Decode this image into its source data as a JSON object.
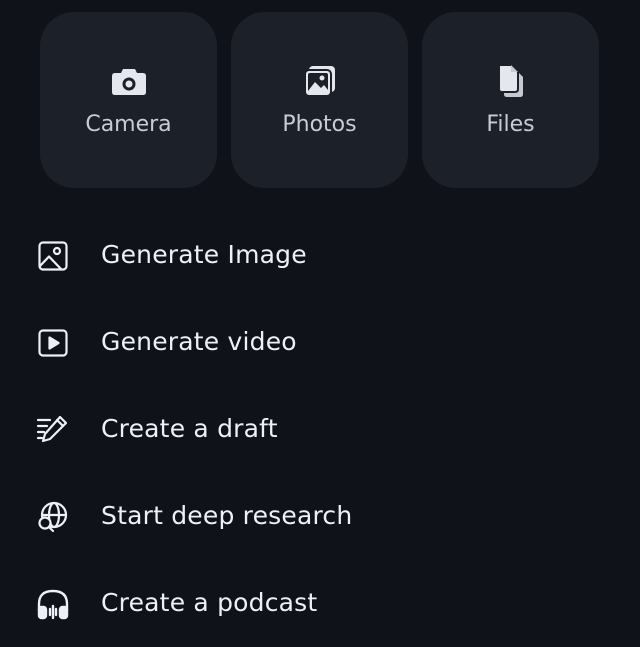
{
  "quick_actions": [
    {
      "label": "Camera",
      "icon": "camera-icon"
    },
    {
      "label": "Photos",
      "icon": "photos-icon"
    },
    {
      "label": "Files",
      "icon": "files-icon"
    }
  ],
  "menu": {
    "items": [
      {
        "label": "Generate Image",
        "icon": "image-icon"
      },
      {
        "label": "Generate video",
        "icon": "video-play-icon"
      },
      {
        "label": "Create a draft",
        "icon": "pen-lines-icon"
      },
      {
        "label": "Start deep research",
        "icon": "globe-search-icon"
      },
      {
        "label": "Create a podcast",
        "icon": "headphones-icon"
      }
    ]
  },
  "colors": {
    "background": "#0f1219",
    "tile_background": "#1c2029",
    "text": "#eef0f5"
  }
}
